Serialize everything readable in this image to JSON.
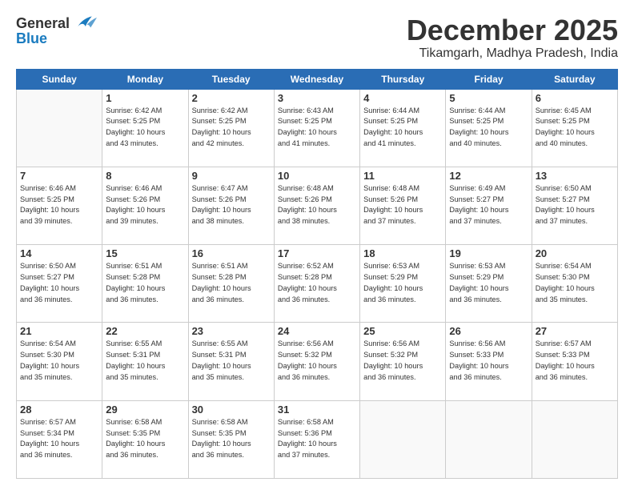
{
  "header": {
    "logo_general": "General",
    "logo_blue": "Blue",
    "title": "December 2025",
    "subtitle": "Tikamgarh, Madhya Pradesh, India"
  },
  "days_of_week": [
    "Sunday",
    "Monday",
    "Tuesday",
    "Wednesday",
    "Thursday",
    "Friday",
    "Saturday"
  ],
  "weeks": [
    [
      {
        "day": "",
        "info": ""
      },
      {
        "day": "1",
        "info": "Sunrise: 6:42 AM\nSunset: 5:25 PM\nDaylight: 10 hours\nand 43 minutes."
      },
      {
        "day": "2",
        "info": "Sunrise: 6:42 AM\nSunset: 5:25 PM\nDaylight: 10 hours\nand 42 minutes."
      },
      {
        "day": "3",
        "info": "Sunrise: 6:43 AM\nSunset: 5:25 PM\nDaylight: 10 hours\nand 41 minutes."
      },
      {
        "day": "4",
        "info": "Sunrise: 6:44 AM\nSunset: 5:25 PM\nDaylight: 10 hours\nand 41 minutes."
      },
      {
        "day": "5",
        "info": "Sunrise: 6:44 AM\nSunset: 5:25 PM\nDaylight: 10 hours\nand 40 minutes."
      },
      {
        "day": "6",
        "info": "Sunrise: 6:45 AM\nSunset: 5:25 PM\nDaylight: 10 hours\nand 40 minutes."
      }
    ],
    [
      {
        "day": "7",
        "info": "Sunrise: 6:46 AM\nSunset: 5:25 PM\nDaylight: 10 hours\nand 39 minutes."
      },
      {
        "day": "8",
        "info": "Sunrise: 6:46 AM\nSunset: 5:26 PM\nDaylight: 10 hours\nand 39 minutes."
      },
      {
        "day": "9",
        "info": "Sunrise: 6:47 AM\nSunset: 5:26 PM\nDaylight: 10 hours\nand 38 minutes."
      },
      {
        "day": "10",
        "info": "Sunrise: 6:48 AM\nSunset: 5:26 PM\nDaylight: 10 hours\nand 38 minutes."
      },
      {
        "day": "11",
        "info": "Sunrise: 6:48 AM\nSunset: 5:26 PM\nDaylight: 10 hours\nand 37 minutes."
      },
      {
        "day": "12",
        "info": "Sunrise: 6:49 AM\nSunset: 5:27 PM\nDaylight: 10 hours\nand 37 minutes."
      },
      {
        "day": "13",
        "info": "Sunrise: 6:50 AM\nSunset: 5:27 PM\nDaylight: 10 hours\nand 37 minutes."
      }
    ],
    [
      {
        "day": "14",
        "info": "Sunrise: 6:50 AM\nSunset: 5:27 PM\nDaylight: 10 hours\nand 36 minutes."
      },
      {
        "day": "15",
        "info": "Sunrise: 6:51 AM\nSunset: 5:28 PM\nDaylight: 10 hours\nand 36 minutes."
      },
      {
        "day": "16",
        "info": "Sunrise: 6:51 AM\nSunset: 5:28 PM\nDaylight: 10 hours\nand 36 minutes."
      },
      {
        "day": "17",
        "info": "Sunrise: 6:52 AM\nSunset: 5:28 PM\nDaylight: 10 hours\nand 36 minutes."
      },
      {
        "day": "18",
        "info": "Sunrise: 6:53 AM\nSunset: 5:29 PM\nDaylight: 10 hours\nand 36 minutes."
      },
      {
        "day": "19",
        "info": "Sunrise: 6:53 AM\nSunset: 5:29 PM\nDaylight: 10 hours\nand 36 minutes."
      },
      {
        "day": "20",
        "info": "Sunrise: 6:54 AM\nSunset: 5:30 PM\nDaylight: 10 hours\nand 35 minutes."
      }
    ],
    [
      {
        "day": "21",
        "info": "Sunrise: 6:54 AM\nSunset: 5:30 PM\nDaylight: 10 hours\nand 35 minutes."
      },
      {
        "day": "22",
        "info": "Sunrise: 6:55 AM\nSunset: 5:31 PM\nDaylight: 10 hours\nand 35 minutes."
      },
      {
        "day": "23",
        "info": "Sunrise: 6:55 AM\nSunset: 5:31 PM\nDaylight: 10 hours\nand 35 minutes."
      },
      {
        "day": "24",
        "info": "Sunrise: 6:56 AM\nSunset: 5:32 PM\nDaylight: 10 hours\nand 36 minutes."
      },
      {
        "day": "25",
        "info": "Sunrise: 6:56 AM\nSunset: 5:32 PM\nDaylight: 10 hours\nand 36 minutes."
      },
      {
        "day": "26",
        "info": "Sunrise: 6:56 AM\nSunset: 5:33 PM\nDaylight: 10 hours\nand 36 minutes."
      },
      {
        "day": "27",
        "info": "Sunrise: 6:57 AM\nSunset: 5:33 PM\nDaylight: 10 hours\nand 36 minutes."
      }
    ],
    [
      {
        "day": "28",
        "info": "Sunrise: 6:57 AM\nSunset: 5:34 PM\nDaylight: 10 hours\nand 36 minutes."
      },
      {
        "day": "29",
        "info": "Sunrise: 6:58 AM\nSunset: 5:35 PM\nDaylight: 10 hours\nand 36 minutes."
      },
      {
        "day": "30",
        "info": "Sunrise: 6:58 AM\nSunset: 5:35 PM\nDaylight: 10 hours\nand 36 minutes."
      },
      {
        "day": "31",
        "info": "Sunrise: 6:58 AM\nSunset: 5:36 PM\nDaylight: 10 hours\nand 37 minutes."
      },
      {
        "day": "",
        "info": ""
      },
      {
        "day": "",
        "info": ""
      },
      {
        "day": "",
        "info": ""
      }
    ]
  ]
}
